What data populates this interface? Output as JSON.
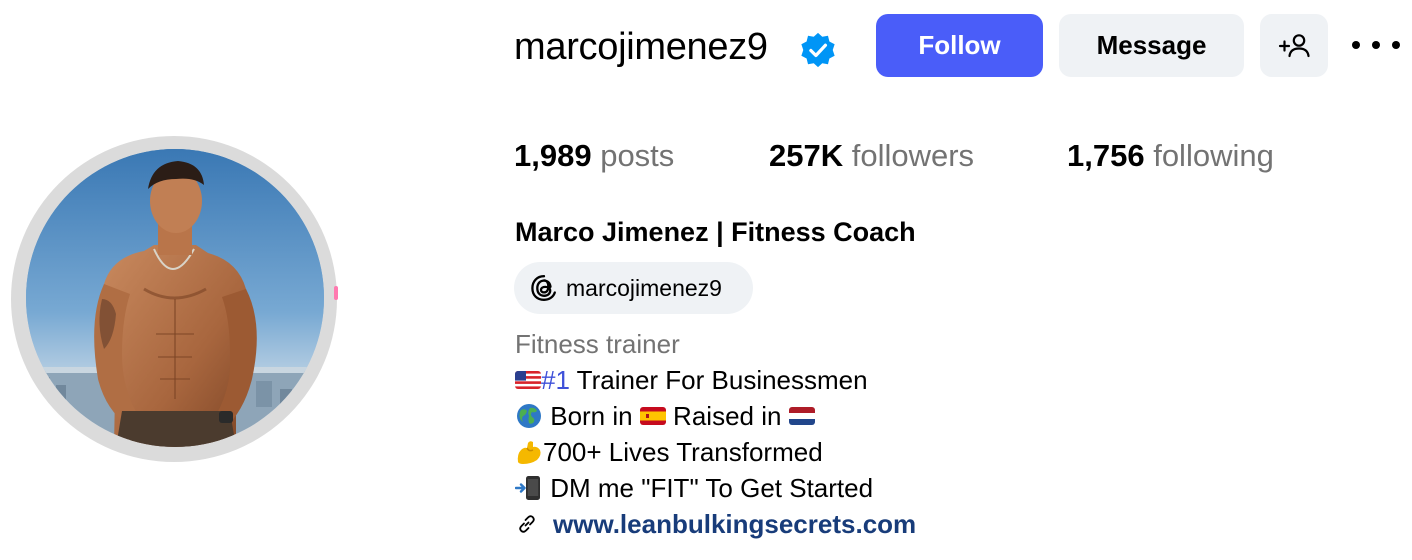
{
  "profile": {
    "username": "marcojimenez9",
    "verified": true,
    "avatar_description": "profile-photo"
  },
  "actions": {
    "follow_label": "Follow",
    "message_label": "Message",
    "suggest_icon": "add-person-icon",
    "more_icon": "more-options-icon"
  },
  "stats": {
    "posts_count": "1,989",
    "posts_label": "posts",
    "followers_count": "257K",
    "followers_label": "followers",
    "following_count": "1,756",
    "following_label": "following"
  },
  "bio": {
    "full_name": "Marco Jimenez | Fitness Coach",
    "threads_handle": "marcojimenez9",
    "category": "Fitness trainer",
    "line1_hashtag": "#1",
    "line1_text": " Trainer For Businessmen",
    "line2_born": " Born in ",
    "line2_raised": " Raised in ",
    "line3_text": "700+ Lives Transformed",
    "line4_text": " DM me \"FIT\" To Get Started",
    "website": "www.leanbulkingsecrets.com"
  },
  "colors": {
    "accent": "#4a5df9",
    "secondary_button": "#eff2f5",
    "muted_text": "#737373",
    "link": "#183c7a",
    "hashtag": "#3f51d9",
    "verified_badge": "#0095f6"
  },
  "icons": {
    "verified": "verified-badge-icon",
    "threads": "threads-icon",
    "link": "link-icon",
    "flag_us": "us-flag-icon",
    "globe": "globe-icon",
    "flag_es": "spain-flag-icon",
    "flag_nl": "netherlands-flag-icon",
    "muscle": "flexed-biceps-icon",
    "phone": "mobile-phone-arrow-icon"
  }
}
